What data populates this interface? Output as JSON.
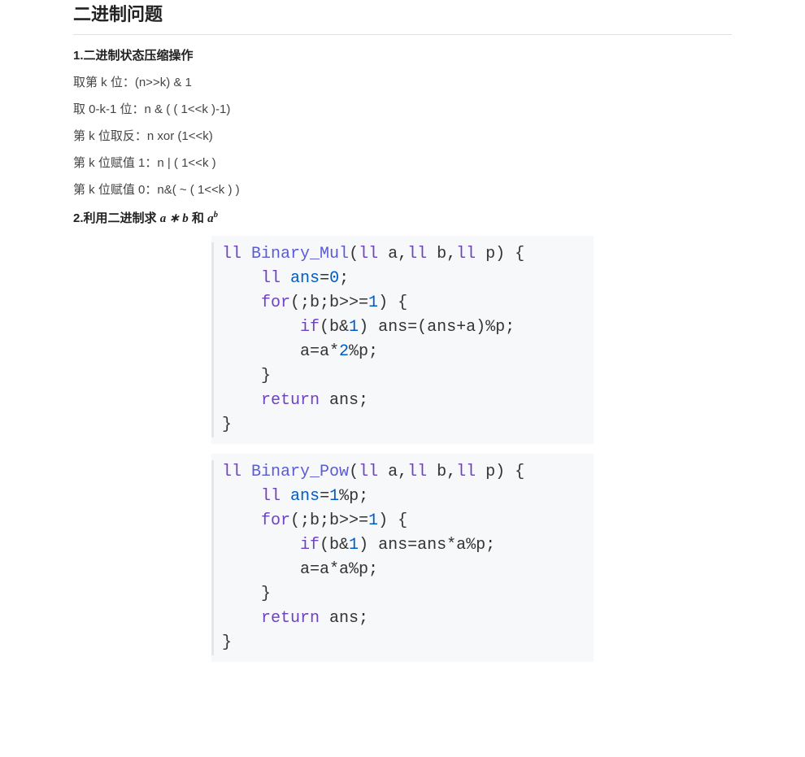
{
  "title": "二进制问题",
  "section1_heading": "1.二进制状态压缩操作",
  "op_bit_k": "取第 k 位：(n>>k) & 1",
  "op_low_bits": "取 0-k-1 位：n & ( ( 1<<k )-1)",
  "op_flip_k": "第 k 位取反：n xor (1<<k)",
  "op_set_k_1": "第 k 位赋值 1：n | ( 1<<k )",
  "op_set_k_0": "第 k 位赋值 0：n&( ~ ( 1<<k ) )",
  "section2_prefix": "2.利用二进制求 ",
  "section2_middle": " 和 ",
  "math_a": "a",
  "math_star": " ∗ ",
  "math_b": "b",
  "code1": {
    "l1a": "ll",
    "l1b": " ",
    "l1c": "Binary_Mul",
    "l1d": "(",
    "l1e": "ll",
    "l1f": " a,",
    "l1g": "ll",
    "l1h": " b,",
    "l1i": "ll",
    "l1j": " p) {",
    "l2a": "    ",
    "l2b": "ll",
    "l2c": " ",
    "l2d": "ans",
    "l2e": "=",
    "l2f": "0",
    "l2g": ";",
    "l3a": "    ",
    "l3b": "for",
    "l3c": "(;b;b>>=",
    "l3d": "1",
    "l3e": ") {",
    "l4a": "        ",
    "l4b": "if",
    "l4c": "(b&",
    "l4d": "1",
    "l4e": ") ans=(ans+a)%p;",
    "l5a": "        a=a*",
    "l5b": "2",
    "l5c": "%p;",
    "l6a": "    }",
    "l7a": "    ",
    "l7b": "return",
    "l7c": " ans;",
    "l8a": "}"
  },
  "code2": {
    "l1a": "ll",
    "l1b": " ",
    "l1c": "Binary_Pow",
    "l1d": "(",
    "l1e": "ll",
    "l1f": " a,",
    "l1g": "ll",
    "l1h": " b,",
    "l1i": "ll",
    "l1j": " p) {",
    "l2a": "    ",
    "l2b": "ll",
    "l2c": " ",
    "l2d": "ans",
    "l2e": "=",
    "l2f": "1",
    "l2g": "%p;",
    "l3a": "    ",
    "l3b": "for",
    "l3c": "(;b;b>>=",
    "l3d": "1",
    "l3e": ") {",
    "l4a": "        ",
    "l4b": "if",
    "l4c": "(b&",
    "l4d": "1",
    "l4e": ") ans=ans*a%p;",
    "l5a": "        a=a*a%p;",
    "l6a": "    }",
    "l7a": "    ",
    "l7b": "return",
    "l7c": " ans;",
    "l8a": "}"
  }
}
